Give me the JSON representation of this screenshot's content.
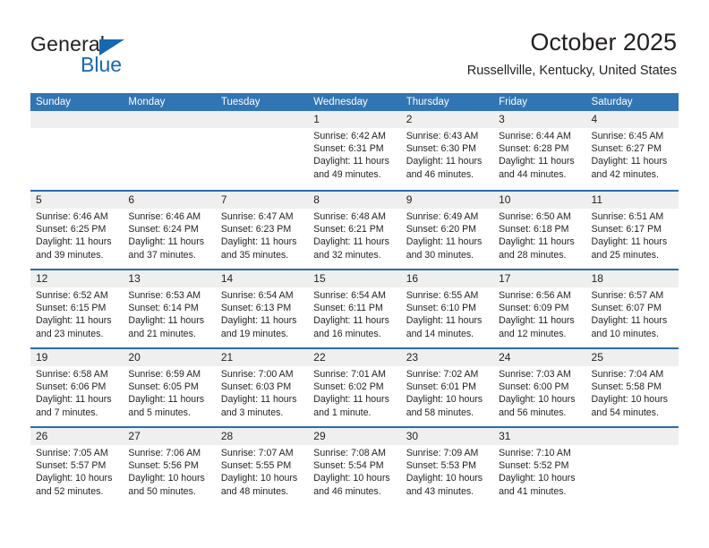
{
  "brand": {
    "name_top": "General",
    "name_bottom": "Blue",
    "accent_color": "#1668b3"
  },
  "header": {
    "title": "October 2025",
    "subtitle": "Russellville, Kentucky, United States"
  },
  "theme": {
    "header_blue": "#3175b4",
    "rule_blue": "#2b6cab",
    "band_gray": "#efefef",
    "text": "#231f20"
  },
  "calendar": {
    "weekday_headers": [
      "Sunday",
      "Monday",
      "Tuesday",
      "Wednesday",
      "Thursday",
      "Friday",
      "Saturday"
    ],
    "labels": {
      "sunrise": "Sunrise:",
      "sunset": "Sunset:",
      "daylight": "Daylight:"
    },
    "weeks": [
      [
        {
          "day": "",
          "line1": "",
          "line2": "",
          "line3": "",
          "line4": ""
        },
        {
          "day": "",
          "line1": "",
          "line2": "",
          "line3": "",
          "line4": ""
        },
        {
          "day": "",
          "line1": "",
          "line2": "",
          "line3": "",
          "line4": ""
        },
        {
          "day": "1",
          "line1": "Sunrise: 6:42 AM",
          "line2": "Sunset: 6:31 PM",
          "line3": "Daylight: 11 hours",
          "line4": "and 49 minutes."
        },
        {
          "day": "2",
          "line1": "Sunrise: 6:43 AM",
          "line2": "Sunset: 6:30 PM",
          "line3": "Daylight: 11 hours",
          "line4": "and 46 minutes."
        },
        {
          "day": "3",
          "line1": "Sunrise: 6:44 AM",
          "line2": "Sunset: 6:28 PM",
          "line3": "Daylight: 11 hours",
          "line4": "and 44 minutes."
        },
        {
          "day": "4",
          "line1": "Sunrise: 6:45 AM",
          "line2": "Sunset: 6:27 PM",
          "line3": "Daylight: 11 hours",
          "line4": "and 42 minutes."
        }
      ],
      [
        {
          "day": "5",
          "line1": "Sunrise: 6:46 AM",
          "line2": "Sunset: 6:25 PM",
          "line3": "Daylight: 11 hours",
          "line4": "and 39 minutes."
        },
        {
          "day": "6",
          "line1": "Sunrise: 6:46 AM",
          "line2": "Sunset: 6:24 PM",
          "line3": "Daylight: 11 hours",
          "line4": "and 37 minutes."
        },
        {
          "day": "7",
          "line1": "Sunrise: 6:47 AM",
          "line2": "Sunset: 6:23 PM",
          "line3": "Daylight: 11 hours",
          "line4": "and 35 minutes."
        },
        {
          "day": "8",
          "line1": "Sunrise: 6:48 AM",
          "line2": "Sunset: 6:21 PM",
          "line3": "Daylight: 11 hours",
          "line4": "and 32 minutes."
        },
        {
          "day": "9",
          "line1": "Sunrise: 6:49 AM",
          "line2": "Sunset: 6:20 PM",
          "line3": "Daylight: 11 hours",
          "line4": "and 30 minutes."
        },
        {
          "day": "10",
          "line1": "Sunrise: 6:50 AM",
          "line2": "Sunset: 6:18 PM",
          "line3": "Daylight: 11 hours",
          "line4": "and 28 minutes."
        },
        {
          "day": "11",
          "line1": "Sunrise: 6:51 AM",
          "line2": "Sunset: 6:17 PM",
          "line3": "Daylight: 11 hours",
          "line4": "and 25 minutes."
        }
      ],
      [
        {
          "day": "12",
          "line1": "Sunrise: 6:52 AM",
          "line2": "Sunset: 6:15 PM",
          "line3": "Daylight: 11 hours",
          "line4": "and 23 minutes."
        },
        {
          "day": "13",
          "line1": "Sunrise: 6:53 AM",
          "line2": "Sunset: 6:14 PM",
          "line3": "Daylight: 11 hours",
          "line4": "and 21 minutes."
        },
        {
          "day": "14",
          "line1": "Sunrise: 6:54 AM",
          "line2": "Sunset: 6:13 PM",
          "line3": "Daylight: 11 hours",
          "line4": "and 19 minutes."
        },
        {
          "day": "15",
          "line1": "Sunrise: 6:54 AM",
          "line2": "Sunset: 6:11 PM",
          "line3": "Daylight: 11 hours",
          "line4": "and 16 minutes."
        },
        {
          "day": "16",
          "line1": "Sunrise: 6:55 AM",
          "line2": "Sunset: 6:10 PM",
          "line3": "Daylight: 11 hours",
          "line4": "and 14 minutes."
        },
        {
          "day": "17",
          "line1": "Sunrise: 6:56 AM",
          "line2": "Sunset: 6:09 PM",
          "line3": "Daylight: 11 hours",
          "line4": "and 12 minutes."
        },
        {
          "day": "18",
          "line1": "Sunrise: 6:57 AM",
          "line2": "Sunset: 6:07 PM",
          "line3": "Daylight: 11 hours",
          "line4": "and 10 minutes."
        }
      ],
      [
        {
          "day": "19",
          "line1": "Sunrise: 6:58 AM",
          "line2": "Sunset: 6:06 PM",
          "line3": "Daylight: 11 hours",
          "line4": "and 7 minutes."
        },
        {
          "day": "20",
          "line1": "Sunrise: 6:59 AM",
          "line2": "Sunset: 6:05 PM",
          "line3": "Daylight: 11 hours",
          "line4": "and 5 minutes."
        },
        {
          "day": "21",
          "line1": "Sunrise: 7:00 AM",
          "line2": "Sunset: 6:03 PM",
          "line3": "Daylight: 11 hours",
          "line4": "and 3 minutes."
        },
        {
          "day": "22",
          "line1": "Sunrise: 7:01 AM",
          "line2": "Sunset: 6:02 PM",
          "line3": "Daylight: 11 hours",
          "line4": "and 1 minute."
        },
        {
          "day": "23",
          "line1": "Sunrise: 7:02 AM",
          "line2": "Sunset: 6:01 PM",
          "line3": "Daylight: 10 hours",
          "line4": "and 58 minutes."
        },
        {
          "day": "24",
          "line1": "Sunrise: 7:03 AM",
          "line2": "Sunset: 6:00 PM",
          "line3": "Daylight: 10 hours",
          "line4": "and 56 minutes."
        },
        {
          "day": "25",
          "line1": "Sunrise: 7:04 AM",
          "line2": "Sunset: 5:58 PM",
          "line3": "Daylight: 10 hours",
          "line4": "and 54 minutes."
        }
      ],
      [
        {
          "day": "26",
          "line1": "Sunrise: 7:05 AM",
          "line2": "Sunset: 5:57 PM",
          "line3": "Daylight: 10 hours",
          "line4": "and 52 minutes."
        },
        {
          "day": "27",
          "line1": "Sunrise: 7:06 AM",
          "line2": "Sunset: 5:56 PM",
          "line3": "Daylight: 10 hours",
          "line4": "and 50 minutes."
        },
        {
          "day": "28",
          "line1": "Sunrise: 7:07 AM",
          "line2": "Sunset: 5:55 PM",
          "line3": "Daylight: 10 hours",
          "line4": "and 48 minutes."
        },
        {
          "day": "29",
          "line1": "Sunrise: 7:08 AM",
          "line2": "Sunset: 5:54 PM",
          "line3": "Daylight: 10 hours",
          "line4": "and 46 minutes."
        },
        {
          "day": "30",
          "line1": "Sunrise: 7:09 AM",
          "line2": "Sunset: 5:53 PM",
          "line3": "Daylight: 10 hours",
          "line4": "and 43 minutes."
        },
        {
          "day": "31",
          "line1": "Sunrise: 7:10 AM",
          "line2": "Sunset: 5:52 PM",
          "line3": "Daylight: 10 hours",
          "line4": "and 41 minutes."
        },
        {
          "day": "",
          "line1": "",
          "line2": "",
          "line3": "",
          "line4": ""
        }
      ]
    ]
  }
}
